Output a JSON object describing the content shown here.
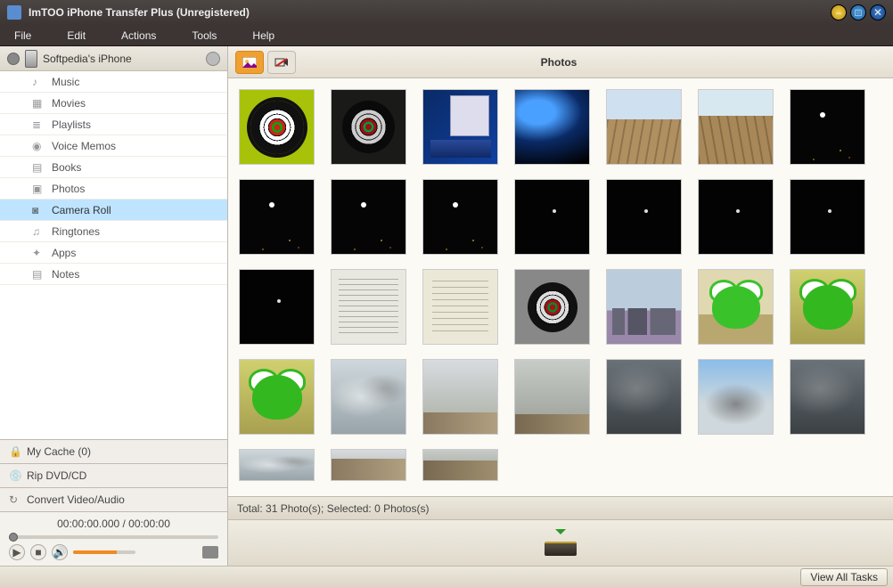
{
  "window": {
    "title": "ImTOO iPhone Transfer Plus (Unregistered)"
  },
  "menu": {
    "file": "File",
    "edit": "Edit",
    "actions": "Actions",
    "tools": "Tools",
    "help": "Help"
  },
  "device": {
    "name": "Softpedia's iPhone"
  },
  "tree": {
    "music": "Music",
    "movies": "Movies",
    "playlists": "Playlists",
    "voice": "Voice Memos",
    "books": "Books",
    "photos": "Photos",
    "camera": "Camera Roll",
    "ringtones": "Ringtones",
    "apps": "Apps",
    "notes": "Notes"
  },
  "sidecards": {
    "cache": "My Cache (0)",
    "rip": "Rip DVD/CD",
    "convert": "Convert Video/Audio"
  },
  "player": {
    "time": "00:00:00.000 / 00:00:00"
  },
  "heading": "Photos",
  "status": "Total: 31 Photo(s); Selected: 0 Photos(s)",
  "footer": {
    "viewall": "View All Tasks"
  },
  "thumbs": [
    {
      "v": "t-dart"
    },
    {
      "v": "t-dartdk"
    },
    {
      "v": "t-desktop"
    },
    {
      "v": "t-abstract"
    },
    {
      "v": "t-tracks"
    },
    {
      "v": "t-tracks2"
    },
    {
      "v": "t-night"
    },
    {
      "v": "t-night"
    },
    {
      "v": "t-night"
    },
    {
      "v": "t-night"
    },
    {
      "v": "t-night-dim"
    },
    {
      "v": "t-night-dim"
    },
    {
      "v": "t-night-dim"
    },
    {
      "v": "t-night-dim"
    },
    {
      "v": "t-night-dim"
    },
    {
      "v": "t-doc"
    },
    {
      "v": "t-doc2"
    },
    {
      "v": "t-dartmid"
    },
    {
      "v": "t-city"
    },
    {
      "v": "t-frog"
    },
    {
      "v": "t-frog2"
    },
    {
      "v": "t-frog2"
    },
    {
      "v": "t-clouds"
    },
    {
      "v": "t-clouds-b"
    },
    {
      "v": "t-clouds-c"
    },
    {
      "v": "t-storm"
    },
    {
      "v": "t-clouds-blue"
    },
    {
      "v": "t-storm"
    },
    {
      "v": "t-clouds",
      "partial": true
    },
    {
      "v": "t-clouds-b",
      "partial": true
    },
    {
      "v": "t-clouds-c",
      "partial": true
    }
  ]
}
